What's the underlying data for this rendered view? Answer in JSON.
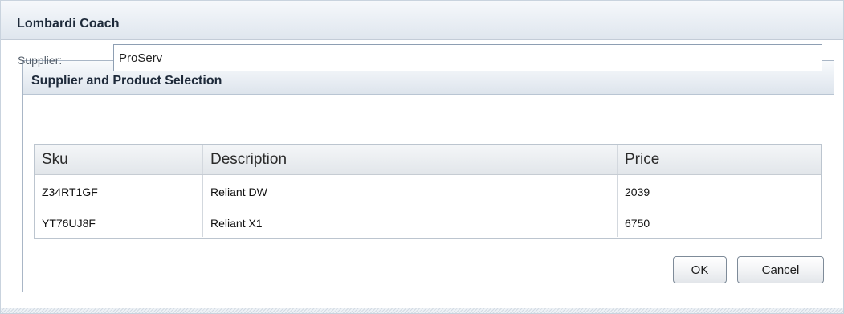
{
  "app": {
    "title": "Lombardi Coach"
  },
  "panel": {
    "title": "Supplier and Product Selection",
    "supplier_label": "Supplier:",
    "supplier_value": "ProServ"
  },
  "table": {
    "columns": [
      "Sku",
      "Description",
      "Price"
    ],
    "rows": [
      {
        "sku": "Z34RT1GF",
        "description": "Reliant DW",
        "price": "2039"
      },
      {
        "sku": "YT76UJ8F",
        "description": "Reliant X1",
        "price": "6750"
      }
    ]
  },
  "buttons": {
    "ok_label": "OK",
    "cancel_label": "Cancel"
  }
}
